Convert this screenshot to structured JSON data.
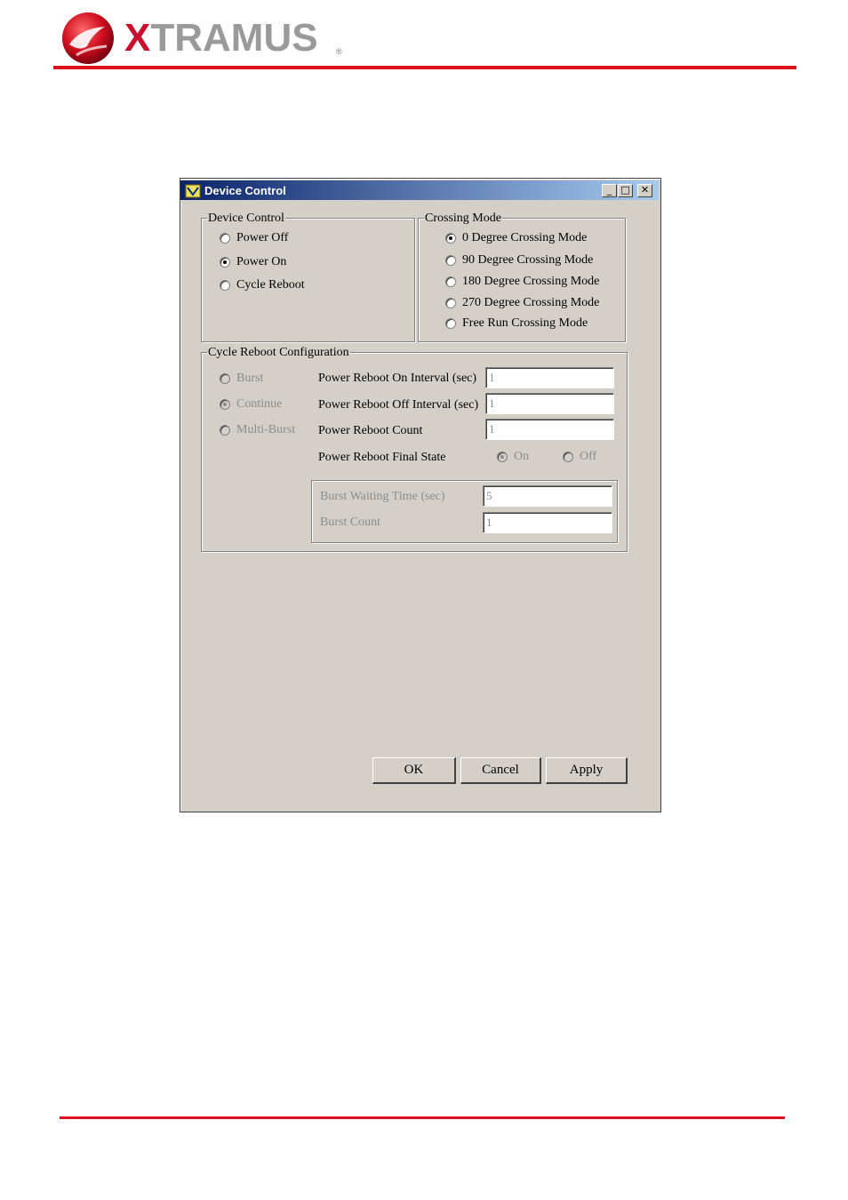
{
  "header": {
    "brand_first": "X",
    "brand_rest": "TRAMUS",
    "brand_reg": "®",
    "logo_icon": "xtramus-logo-icon",
    "accent_color": "#e0101e"
  },
  "window": {
    "title": "Device Control",
    "icon": "app-window-icon",
    "caption_buttons": {
      "minimize": "_",
      "maximize": "□",
      "close": "✕"
    }
  },
  "device_control": {
    "legend": "Device Control",
    "options": [
      {
        "label": "Power Off",
        "checked": false
      },
      {
        "label": "Power On",
        "checked": true
      },
      {
        "label": "Cycle Reboot",
        "checked": false
      }
    ]
  },
  "crossing_mode": {
    "legend": "Crossing Mode",
    "options": [
      {
        "label": "0 Degree Crossing Mode",
        "checked": true
      },
      {
        "label": "90 Degree Crossing Mode",
        "checked": false
      },
      {
        "label": "180 Degree Crossing Mode",
        "checked": false
      },
      {
        "label": "270 Degree Crossing Mode",
        "checked": false
      },
      {
        "label": "Free Run Crossing Mode",
        "checked": false
      }
    ]
  },
  "cycle_reboot": {
    "legend": "Cycle Reboot Configuration",
    "modes": [
      {
        "label": "Burst",
        "checked": false
      },
      {
        "label": "Continue",
        "checked": true
      },
      {
        "label": "Multi-Burst",
        "checked": false
      }
    ],
    "on_interval_label": "Power Reboot On Interval (sec)",
    "on_interval_value": "1",
    "off_interval_label": "Power Reboot Off Interval (sec)",
    "off_interval_value": "1",
    "count_label": "Power Reboot Count",
    "count_value": "1",
    "final_state_label": "Power Reboot Final State",
    "final_state_on": "On",
    "final_state_off": "Off",
    "final_state_selected": "On",
    "burst_waiting_label": "Burst Waiting Time (sec)",
    "burst_waiting_value": "5",
    "burst_count_label": "Burst Count",
    "burst_count_value": "1"
  },
  "buttons": {
    "ok": "OK",
    "cancel": "Cancel",
    "apply": "Apply"
  }
}
